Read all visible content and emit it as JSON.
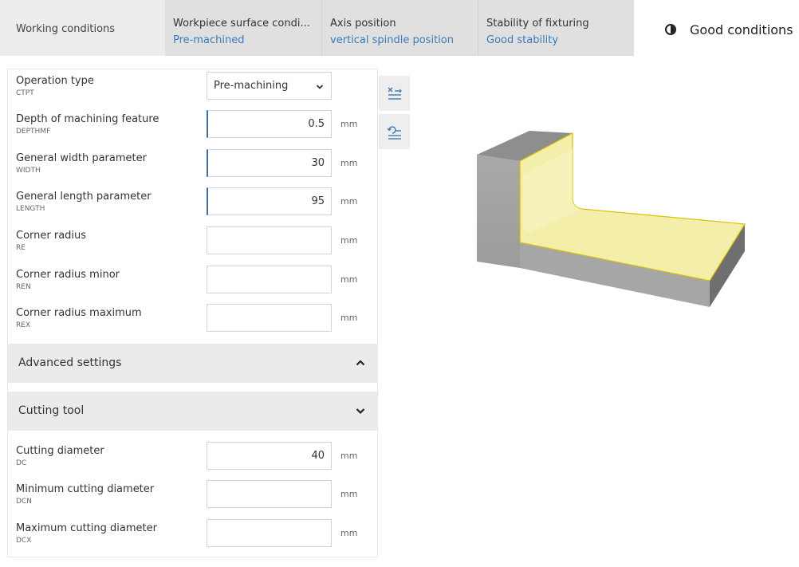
{
  "tabs": {
    "working_conditions": "Working conditions",
    "workpiece": {
      "label": "Workpiece surface condi...",
      "value": "Pre-machined"
    },
    "axis": {
      "label": "Axis position",
      "value": "vertical spindle position"
    },
    "stability": {
      "label": "Stability of fixturing",
      "value": "Good stability"
    },
    "conditions": "Good conditions"
  },
  "form": {
    "operation_type": {
      "label": "Operation type",
      "code": "CTPT",
      "value": "Pre-machining"
    },
    "fields": [
      {
        "label": "Depth of machining feature",
        "code": "DEPTHMF",
        "value": "0.5",
        "unit": "mm"
      },
      {
        "label": "General width parameter",
        "code": "WIDTH",
        "value": "30",
        "unit": "mm"
      },
      {
        "label": "General length parameter",
        "code": "LENGTH",
        "value": "95",
        "unit": "mm"
      },
      {
        "label": "Corner radius",
        "code": "RE",
        "value": "",
        "unit": "mm"
      },
      {
        "label": "Corner radius minor",
        "code": "REN",
        "value": "",
        "unit": "mm"
      },
      {
        "label": "Corner radius maximum",
        "code": "REX",
        "value": "",
        "unit": "mm"
      }
    ]
  },
  "sections": {
    "advanced": "Advanced settings",
    "cutting_tool": "Cutting tool"
  },
  "tool_fields": [
    {
      "label": "Cutting diameter",
      "code": "DC",
      "value": "40",
      "unit": "mm"
    },
    {
      "label": "Minimum cutting diameter",
      "code": "DCN",
      "value": "",
      "unit": "mm"
    },
    {
      "label": "Maximum cutting diameter",
      "code": "DCX",
      "value": "",
      "unit": "mm"
    }
  ],
  "colors": {
    "accent": "#3a6ea5",
    "link": "#3a7bb8",
    "highlight_face": "#f3efaa"
  },
  "icons": [
    "half-circle-icon",
    "chevron-down-icon",
    "chevron-up-icon",
    "clear-values-icon",
    "reset-values-icon"
  ]
}
